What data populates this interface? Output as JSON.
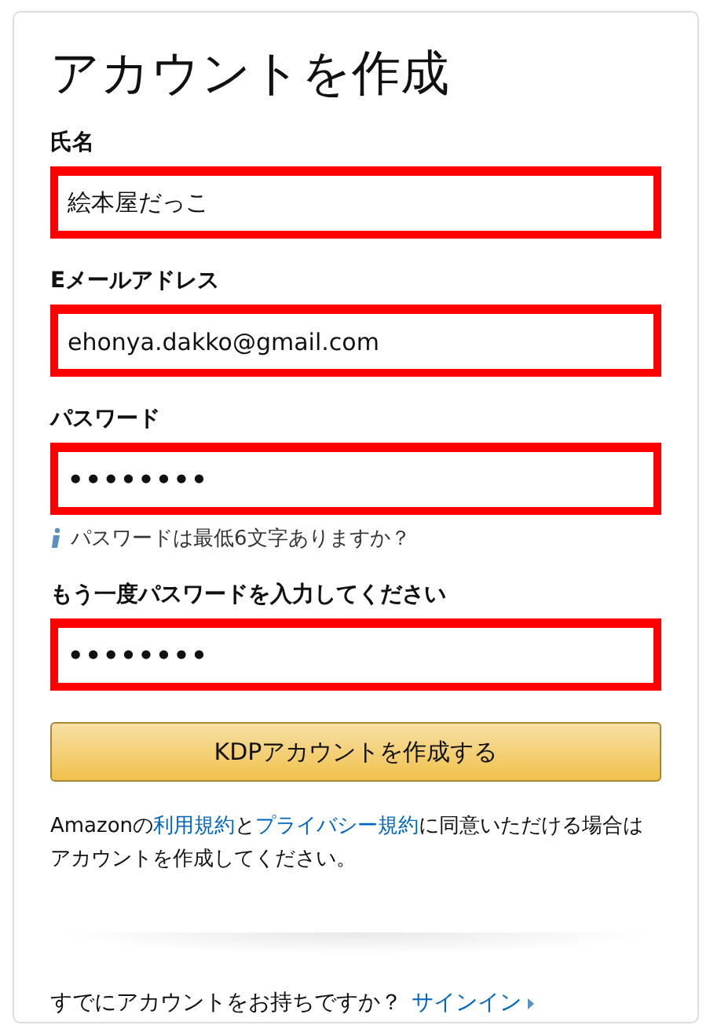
{
  "title": "アカウントを作成",
  "fields": [
    {
      "label": "氏名",
      "value": "絵本屋だっこ",
      "highlighted": true
    },
    {
      "label": "Eメールアドレス",
      "value": "ehonya.dakko@gmail.com",
      "highlighted": true
    },
    {
      "label": "パスワード",
      "value": "••••••••",
      "highlighted": true,
      "hint": "パスワードは最低6文字ありますか？"
    },
    {
      "label": "もう一度パスワードを入力してください",
      "value": "••••••••",
      "highlighted": true
    }
  ],
  "submit_button": "KDPアカウントを作成する",
  "terms": [
    {
      "kind": "text",
      "text": "Amazonの"
    },
    {
      "kind": "link",
      "text": "利用規約"
    },
    {
      "kind": "text",
      "text": "と"
    },
    {
      "kind": "link",
      "text": "プライバシー規約"
    },
    {
      "kind": "text",
      "text": "に同意いただける場合はアカウントを作成してください。"
    }
  ],
  "signin": {
    "prompt": "すでにアカウントをお持ちですか？",
    "link": "サインイン"
  }
}
